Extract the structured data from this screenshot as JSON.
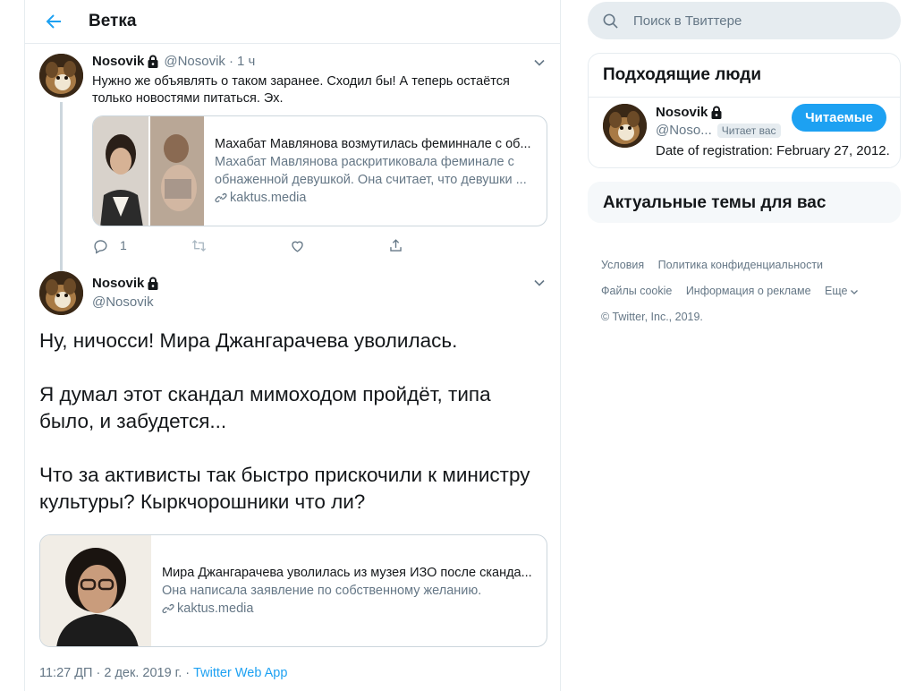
{
  "header": {
    "title": "Ветка"
  },
  "parent_tweet": {
    "name": "Nosovik",
    "handle": "@Nosovik",
    "separator": "·",
    "time": "1 ч",
    "text": "Нужно же объявлять о таком заранее. Сходил бы! А теперь остаётся только новостями питаться. Эх.",
    "card": {
      "title": "Махабат Мавлянова возмутилась феминнале с об...",
      "description": "Махабат Мавлянова раскритиковала феминале с обнаженной девушкой. Она считает, что девушки ...",
      "domain": "kaktus.media"
    },
    "actions": {
      "reply_count": "1",
      "retweet_count": "",
      "like_count": ""
    }
  },
  "focal_tweet": {
    "name": "Nosovik",
    "handle": "@Nosovik",
    "paragraphs": [
      "Ну, ничосси! Мира Джангарачева уволилась.",
      "Я думал этот скандал мимоходом пройдёт, типа было, и забудется...",
      "Что за активисты так быстро прискочили к министру культуры? Кыркчорошники что ли?"
    ],
    "card": {
      "title": "Мира Джангарачева уволилась из музея ИЗО после сканда...",
      "description": "Она написала заявление по собственному желанию.",
      "domain": "kaktus.media"
    },
    "timestamp": "11:27 ДП · 2 дек. 2019 г. · ",
    "app": "Twitter Web App"
  },
  "search": {
    "placeholder": "Поиск в Твиттере"
  },
  "people_panel": {
    "title": "Подходящие люди",
    "name": "Nosovik",
    "handle": "@Noso...",
    "follows_you": "Читает вас",
    "follow_button": "Читаемые",
    "bio": "Date of registration: February 27, 2012."
  },
  "trends_panel": {
    "title": "Актуальные темы для вас"
  },
  "footer": {
    "links": [
      "Условия",
      "Политика конфиденциальности",
      "Файлы cookie",
      "Информация о рекламе",
      "Еще"
    ],
    "copyright": "© Twitter, Inc., 2019."
  },
  "colors": {
    "accent": "#1da1f2",
    "text": "#14171a",
    "secondary": "#657786",
    "border": "#e6ecf0"
  }
}
